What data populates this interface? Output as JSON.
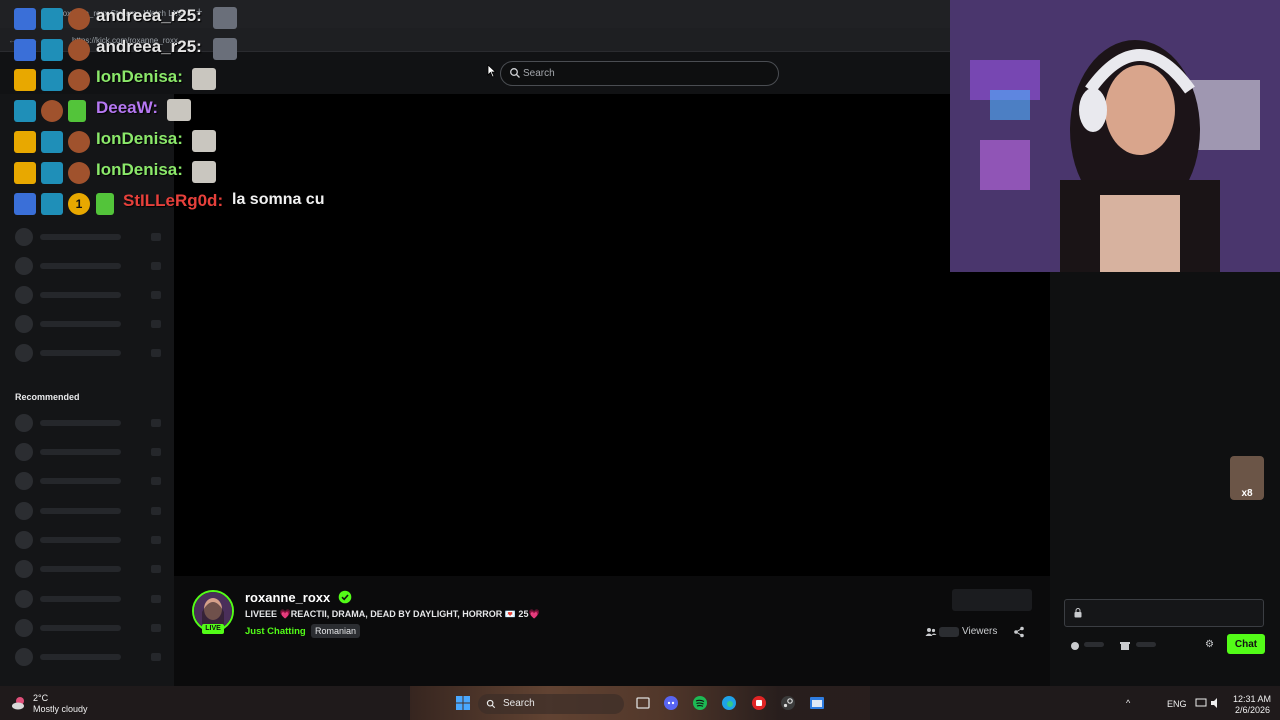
{
  "browser": {
    "tab_title": "roxanne_roxx Stream - Watch Live",
    "url": "https://kick.com/roxanne_roxx"
  },
  "header": {
    "search_placeholder": "Search"
  },
  "sidebar": {
    "recommended_label": "Recommended"
  },
  "overlay_chat": [
    {
      "user": "andreea_r25:",
      "color": "#e5e5e5",
      "text": ""
    },
    {
      "user": "andreea_r25:",
      "color": "#e5e5e5",
      "text": ""
    },
    {
      "user": "IonDenisa:",
      "color": "#8be86a",
      "text": ""
    },
    {
      "user": "DeeaW:",
      "color": "#b678f2",
      "text": ""
    },
    {
      "user": "IonDenisa:",
      "color": "#8be86a",
      "text": ""
    },
    {
      "user": "IonDenisa:",
      "color": "#8be86a",
      "text": ""
    },
    {
      "user": "StILLeRg0d:",
      "color": "#e6403b",
      "text": "la somna cu",
      "sub_badge": "1"
    }
  ],
  "stream": {
    "streamer": "roxanne_roxx",
    "live_label": "LIVE",
    "title": "LIVEEE 💗REACTII, DRAMA, DEAD BY DAYLIGHT, HORROR 💌 25💗",
    "category": "Just Chatting",
    "language": "Romanian",
    "viewers_label": "Viewers"
  },
  "chat": {
    "chat_button": "Chat"
  },
  "taskbar": {
    "weather_temp": "2°C",
    "weather_desc": "Mostly cloudy",
    "search_label": "Search",
    "lang": "ENG",
    "time": "12:31 AM",
    "date": "2/6/2026"
  },
  "colors": {
    "brand": "#53fc18",
    "background": "#0b0b0c",
    "sidebar": "#141517"
  }
}
